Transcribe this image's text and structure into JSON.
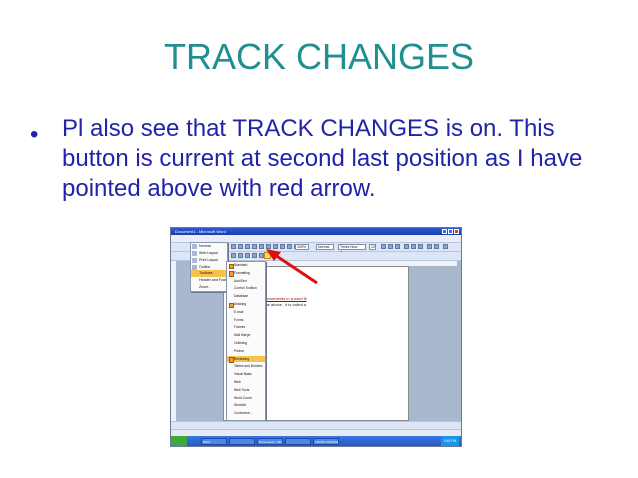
{
  "slide": {
    "title": "TRACK CHANGES",
    "bullet": "Pl also see that TRACK CHANGES  is on. This button is current at second last position as I have pointed above with red arrow."
  },
  "screenshot": {
    "window_title": "Document1 - Microsoft Word",
    "menubar": [
      "File",
      "Edit",
      "View",
      "Insert",
      "Format",
      "Tools",
      "Table",
      "Window",
      "Help"
    ],
    "zoom": "100%",
    "style_value": "Normal",
    "font_value": "Times New Roman",
    "font_size": "12",
    "view_menu": [
      "Normal",
      "Web Layout",
      "Print Layout",
      "Outline",
      "Toolbars",
      "Header and Footer",
      "Zoom..."
    ],
    "toolbars_menu": [
      {
        "label": "Standard",
        "checked": true
      },
      {
        "label": "Formatting",
        "checked": true
      },
      {
        "label": "AutoText",
        "checked": false
      },
      {
        "label": "Control Toolbox",
        "checked": false
      },
      {
        "label": "Database",
        "checked": false
      },
      {
        "label": "Drawing",
        "checked": true
      },
      {
        "label": "E-mail",
        "checked": false
      },
      {
        "label": "Forms",
        "checked": false
      },
      {
        "label": "Frames",
        "checked": false
      },
      {
        "label": "Mail Merge",
        "checked": false
      },
      {
        "label": "Outlining",
        "checked": false
      },
      {
        "label": "Picture",
        "checked": false
      },
      {
        "label": "Reviewing",
        "checked": true
      },
      {
        "label": "Tables and Borders",
        "checked": false
      },
      {
        "label": "Visual Basic",
        "checked": false
      },
      {
        "label": "Web",
        "checked": false
      },
      {
        "label": "Web Tools",
        "checked": false
      },
      {
        "label": "Word Count",
        "checked": false
      },
      {
        "label": "WordArt",
        "checked": false
      },
      {
        "label": "Customize...",
        "checked": false
      }
    ],
    "doc_lines": [
      "ur",
      "ert comments in a word fil",
      "of he above , it is called a"
    ],
    "drawbar_label": "Draw  AutoShapes",
    "status": [
      "Page 1",
      "Sec 1",
      "1/1",
      "At 1\"",
      "Ln 1",
      "Col 1",
      "REC TRK EXT OVR",
      "English (U.S"
    ],
    "taskbar": [
      "start",
      "Word",
      "",
      "Document1 - Micro",
      "",
      "TRACK CHANGES.ppt"
    ],
    "clock": "3:45 PM"
  },
  "colors": {
    "title": "#1f8f8f",
    "bullet": "#2222aa",
    "arrow": "#dd1111",
    "highlight": "#f6c24c"
  }
}
